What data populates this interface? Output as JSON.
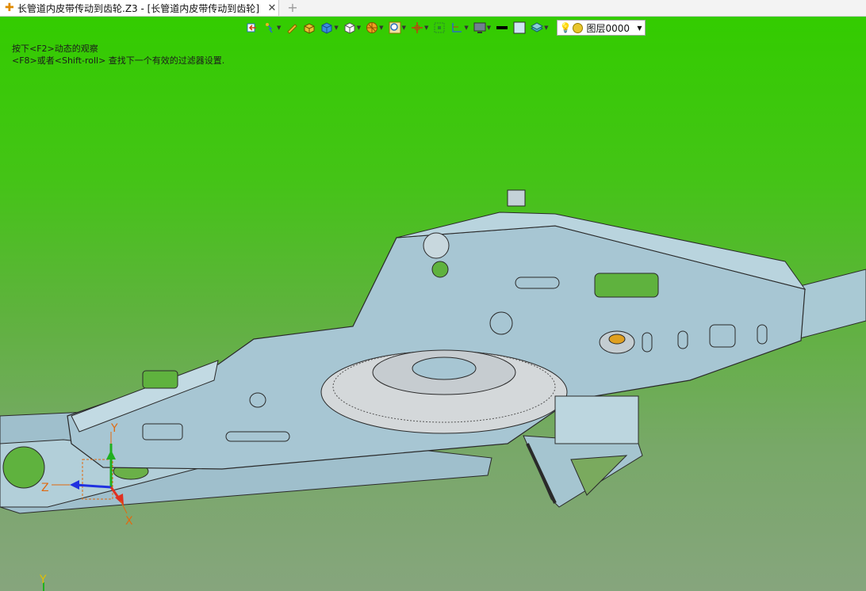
{
  "tab": {
    "title": "长管道内皮带传动到齿轮.Z3 - [长管道内皮带传动到齿轮]",
    "close_glyph": "✕",
    "new_tab_glyph": "+"
  },
  "viewport": {
    "hint_line1": "按下<F2>动态的观察",
    "hint_line2": "<F8>或者<Shift-roll> 查找下一个有效的过滤器设置."
  },
  "toolbar": {
    "icons": [
      "insert-icon",
      "filter-icon",
      "pencil-icon",
      "solid-box-icon",
      "cube-shaded-icon",
      "cube-white-icon",
      "texture-icon",
      "zoom-icon",
      "move-icon",
      "plane-icon",
      "workplane-icon",
      "display-icon",
      "line-style-icon",
      "color-icon",
      "layer-stack-icon"
    ],
    "layer": {
      "label": "图层0000",
      "icon": "bulb-icon"
    }
  },
  "axes": {
    "x": "X",
    "y": "Y",
    "z": "Z"
  },
  "colors": {
    "viewport_top": "#33cc00",
    "viewport_bottom": "#86a57d",
    "model_fill": "#a7c6d3",
    "model_edge": "#2a2a2a",
    "axis_x": "#e03020",
    "axis_y": "#20b020",
    "axis_z": "#2030e0"
  }
}
